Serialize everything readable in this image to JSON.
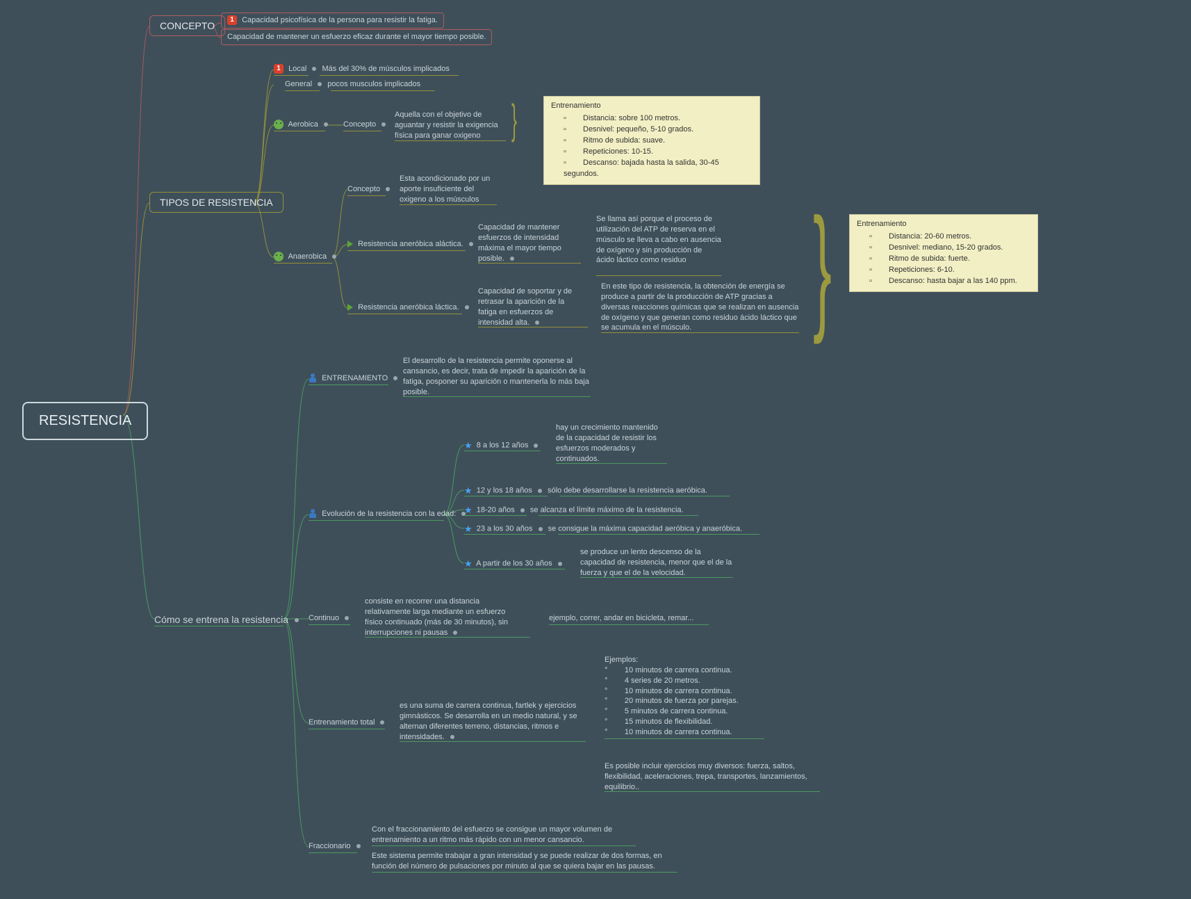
{
  "root": "RESISTENCIA",
  "concepto": {
    "label": "CONCEPTO",
    "line1": "Capacidad psicofísica de la persona para resistir la fatiga.",
    "line2": "Capacidad de mantener un esfuerzo eficaz durante el mayor tiempo posible."
  },
  "tipos": {
    "label": "TIPOS DE RESISTENCIA",
    "local": {
      "label": "Local",
      "text": "Más del 30% de músculos implicados"
    },
    "general": {
      "label": "General",
      "text": "pocos musculos implicados"
    },
    "aerobica": {
      "label": "Aerobica",
      "concepto_label": "Concepto",
      "concepto_text": "Aquella con el objetivo de aguantar y resistir la exigencia física para ganar oxigeno"
    },
    "anaerobica": {
      "label": "Anaerobica",
      "concepto_label": "Concepto",
      "concepto_text": "Esta acondicionado por un aporte insuficiente del oxigeno a los músculos",
      "alactica": {
        "label": "Resistencia aneróbica aláctica.",
        "def": "Capacidad de mantener esfuerzos de intensidad máxima el mayor tiempo posible.",
        "expl": "Se llama así porque el proceso de utilización del ATP de reserva en el músculo se lleva a cabo en ausencia de oxígeno y sin producción de ácido láctico como residuo"
      },
      "lactica": {
        "label": "Resistencia aneróbica láctica.",
        "def": "Capacidad de soportar y de retrasar la aparición de la fatiga en esfuerzos de intensidad alta.",
        "expl": "En este tipo de resistencia, la obtención de energía se produce a partir de la producción de ATP gracias a diversas reacciones químicas que se realizan en ausencia de oxígeno y que generan como residuo ácido láctico que se acumula en el músculo."
      }
    }
  },
  "note1": {
    "title": "Entrenamiento",
    "items": [
      "Distancia: sobre 100 metros.",
      "Desnivel: pequeño, 5-10 grados.",
      "Ritmo de subida: suave.",
      "Repeticiones: 10-15.",
      "Descanso: bajada hasta la salida, 30-45 segundos."
    ]
  },
  "note2": {
    "title": "Entrenamiento",
    "items": [
      "Distancia: 20-60 metros.",
      "Desnivel: mediano, 15-20 grados.",
      "Ritmo de subida: fuerte.",
      "Repeticiones: 6-10.",
      "Descanso: hasta bajar a las 140 ppm."
    ]
  },
  "como": {
    "label": "Cómo se entrena la resistencia",
    "entrenamiento": {
      "label": "ENTRENAMIENTO",
      "text": "El desarrollo de la resistencia permite oponerse al cansancio, es decir, trata de impedir la aparición de la fatiga, posponer su aparición o mantenerla lo más baja posible."
    },
    "evolucion": {
      "label": "Evolución de la resistencia con la edad:",
      "r1": {
        "age": "8 a los 12 años",
        "text": "hay un crecimiento mantenido de la capacidad de resistir los esfuerzos moderados y continuados."
      },
      "r2": {
        "age": "12 y los 18 años",
        "text": "sólo debe desarrollarse la resistencia aeróbica."
      },
      "r3": {
        "age": "18-20 años",
        "text": "se alcanza el límite máximo de la resistencia."
      },
      "r4": {
        "age": "23 a los 30 años",
        "text": "se consigue la máxima capacidad aeróbica y anaeróbica."
      },
      "r5": {
        "age": "A partir de los 30 años",
        "text": "se produce un lento descenso de la capacidad de resistencia, menor que el de la fuerza y que el de la velocidad."
      }
    },
    "continuo": {
      "label": "Continuo",
      "def": "consiste en recorrer una distancia relativamente larga mediante un esfuerzo físico continuado (más de 30 minutos), sin interrupciones ni pausas",
      "ej": "ejemplo, correr, andar en bicicleta, remar..."
    },
    "total": {
      "label": "Entrenamiento total",
      "def": "es una suma de carrera continua, fartlek y ejercicios gimnásticos. Se desarrolla en un medio natural, y se alternan diferentes terreno, distancias, ritmos e intensidades.",
      "ej_title": "Ejemplos:",
      "ej": [
        "10 minutos de carrera continua.",
        "4 series de 20 metros.",
        "10 minutos de carrera continua.",
        "20 minutos de fuerza por parejas.",
        "5 minutos de carrera continua.",
        "15 minutos de flexibilidad.",
        "10 minutos de carrera continua."
      ],
      "extra": "Es posible incluir ejercicios muy diversos: fuerza, saltos, flexibilidad, aceleraciones, trepa, transportes, lanzamientos, equilibrio.."
    },
    "fraccionario": {
      "label": "Fraccionario",
      "l1": "Con el fraccionamiento del esfuerzo se consigue un mayor volumen de entrenamiento a un ritmo más rápido con un menor cansancio.",
      "l2": "Este sistema permite trabajar a gran intensidad y se puede realizar de dos formas, en función del número de pulsaciones por minuto al que se quiera bajar en las pausas."
    }
  }
}
